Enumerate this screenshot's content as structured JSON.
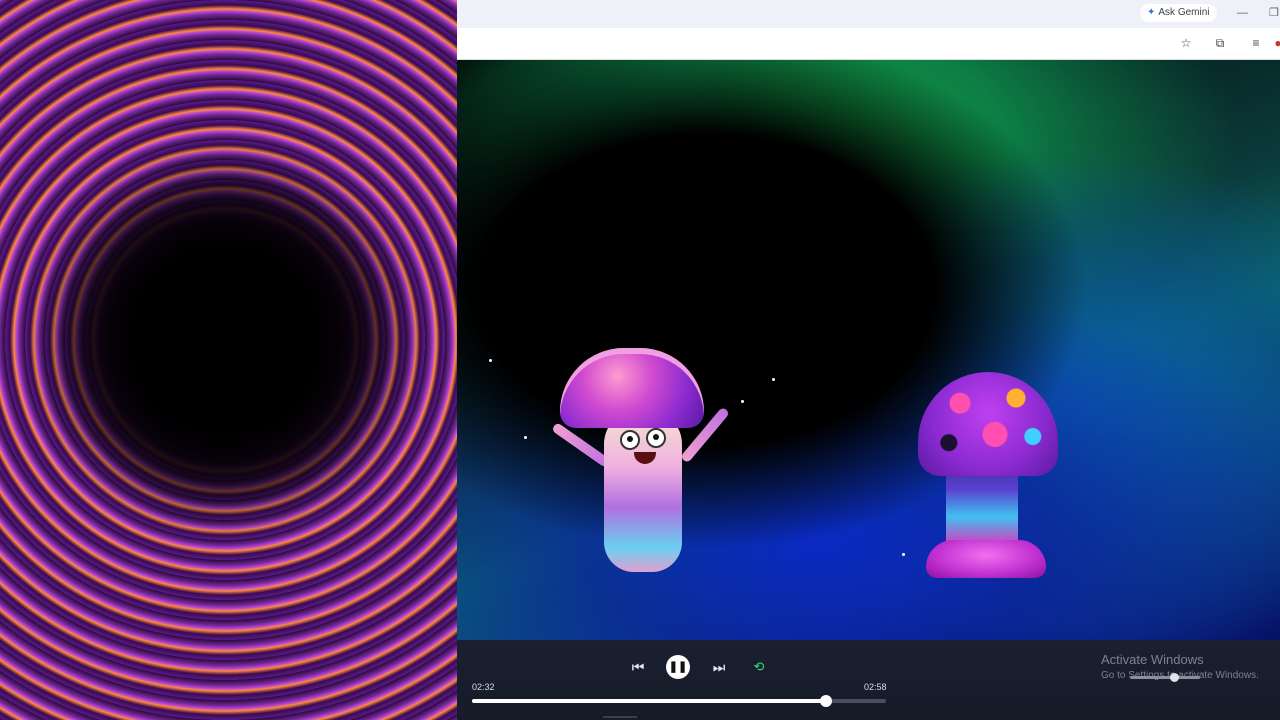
{
  "browser": {
    "gemini_label": "Ask Gemini",
    "minimize_glyph": "—",
    "restore_glyph": "❐",
    "icons": [
      "star-icon",
      "extensions-icon",
      "media-controls-icon",
      "profile-icon"
    ]
  },
  "player": {
    "current_time": "02:32",
    "total_time": "02:58",
    "progress": 0.854,
    "state": "playing",
    "buttons": {
      "previous": "⏮",
      "pause": "❚❚",
      "next": "⏭",
      "repeat": "🔁"
    },
    "accent_color": "#2ee07a"
  },
  "watermark": {
    "title": "Activate Windows",
    "subtitle": "Go to Settings to activate Windows."
  }
}
